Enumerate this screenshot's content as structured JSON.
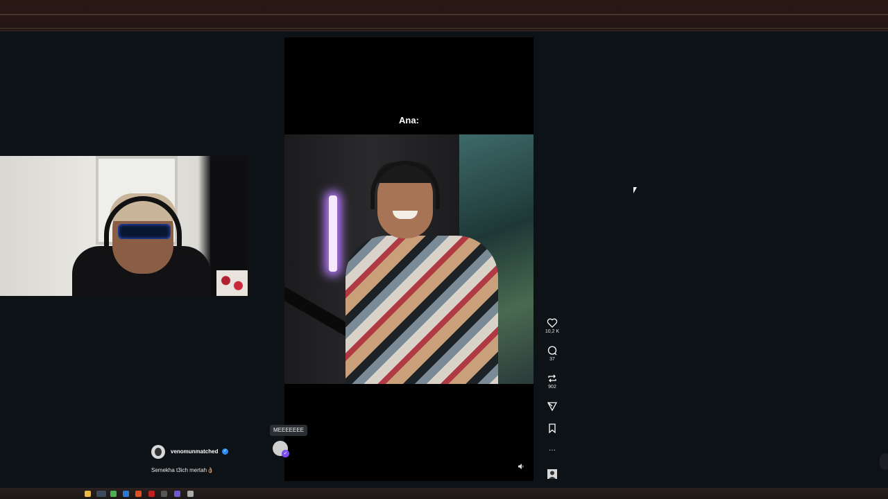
{
  "video": {
    "caption": "Ana:"
  },
  "actions": {
    "like_count": "10,2 K",
    "comment_count": "37",
    "repost_count": "902",
    "more_label": "···"
  },
  "comment_bubble": {
    "text": "MEEEEEEE"
  },
  "author": {
    "username": "venomunmatched",
    "description": "Semekha t3ich mertah👌🏽"
  },
  "taskbar": {
    "icons": [
      "file-explorer-icon",
      "chrome-icon",
      "app-icon",
      "photoshop-icon",
      "firefox-icon",
      "opera-icon",
      "obs-icon",
      "discord-icon",
      "settings-icon"
    ]
  },
  "colors": {
    "background": "#0d1216",
    "player": "#000000",
    "verified": "#2d8cf0"
  }
}
